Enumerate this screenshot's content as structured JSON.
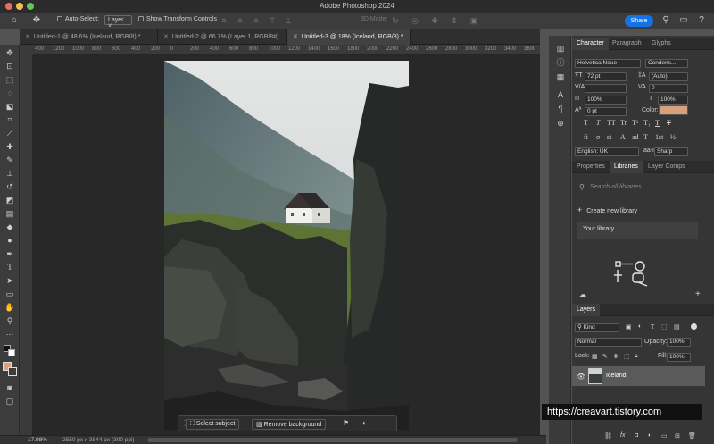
{
  "app": {
    "title": "Adobe Photoshop 2024"
  },
  "options_bar": {
    "auto_select_label": "Auto-Select:",
    "auto_select_value": "Layer",
    "show_transform_label": "Show Transform Controls",
    "mode_3d_label": "3D Mode:",
    "share_label": "Share"
  },
  "tabs": [
    {
      "label": "Untitled-1 @ 48.6% (Iceland, RGB/8) *"
    },
    {
      "label": "Untitled-2 @ 66.7% (Layer 1, RGB/8#)"
    },
    {
      "label": "Untitled-3 @ 18% (Iceland, RGB/8) *"
    }
  ],
  "ruler": {
    "ticks": [
      "400",
      "1200",
      "1000",
      "800",
      "600",
      "400",
      "200",
      "0",
      "200",
      "400",
      "600",
      "800",
      "1000",
      "1200",
      "1400",
      "1600",
      "1800",
      "2000",
      "2200",
      "2400",
      "2600",
      "2800",
      "3000",
      "3200",
      "3400",
      "3600",
      "3800",
      "4000"
    ]
  },
  "context_bar": {
    "select_subject": "Select subject",
    "remove_background": "Remove background"
  },
  "status": {
    "zoom": "17.98%",
    "doc_info": "2550 px x 3844 px (300 ppi)"
  },
  "character": {
    "tabs": [
      "Character",
      "Paragraph",
      "Glyphs"
    ],
    "font_family": "Helvetica Neue",
    "font_style": "Condens...",
    "font_size": "72 pt",
    "leading": "(Auto)",
    "tracking": "0",
    "kerning": "",
    "vscale": "100%",
    "hscale": "100%",
    "baseline": "0 pt",
    "color_label": "Color:",
    "color_swatch": "#d9a07c",
    "language": "English: UK",
    "antialias_icon": "aa-icon",
    "antialias": "Sharp",
    "glyph_row1": [
      "T",
      "T",
      "TT",
      "Tr",
      "T¹",
      "T₁",
      "T",
      "T"
    ],
    "glyph_row2": [
      "fi",
      "σ",
      "st",
      "A",
      "ad",
      "T",
      "1st",
      "½"
    ]
  },
  "libraries": {
    "tabs": [
      "Properties",
      "Libraries",
      "Layer Comps"
    ],
    "search_placeholder": "Search all libraries",
    "create_label": "Create new library",
    "your_library": "Your library"
  },
  "layers": {
    "tab": "Layers",
    "filter": "Kind",
    "blend_mode": "Normal",
    "opacity_label": "Opacity:",
    "opacity": "100%",
    "lock_label": "Lock:",
    "fill_label": "Fill:",
    "fill": "100%",
    "items": [
      {
        "name": "Iceland"
      }
    ]
  },
  "watermark": "https://creavart.tistory.com"
}
